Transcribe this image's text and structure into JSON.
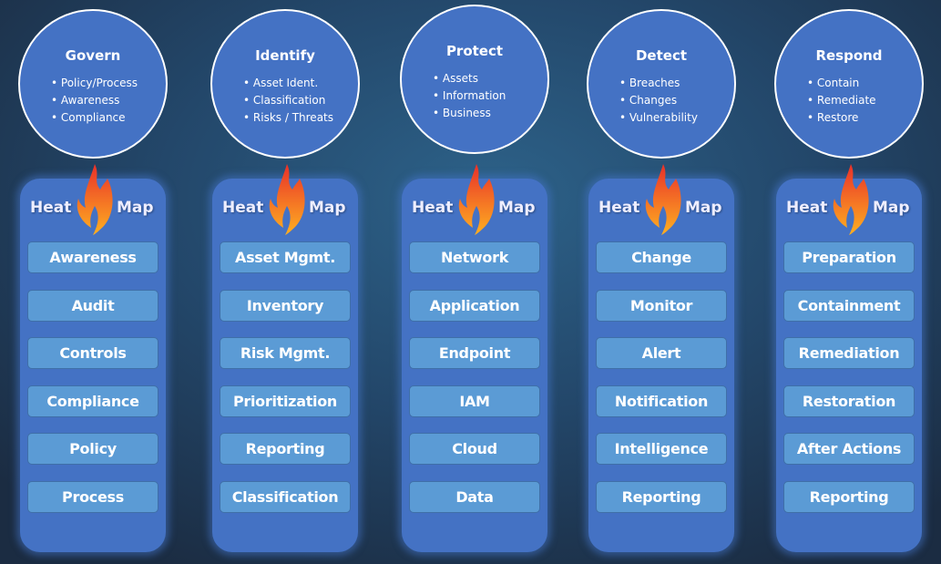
{
  "heat_label": "Heat",
  "map_label": "Map",
  "colors": {
    "circle": "#4472c4",
    "panel": "#4472c4",
    "button": "#5b9bd5",
    "flame_top": "#e8302a",
    "flame_bottom": "#ffb020"
  },
  "icons": {
    "flame": "flame-icon"
  },
  "columns": [
    {
      "title": "Govern",
      "bullets": [
        "Policy/Process",
        "Awareness",
        "Compliance"
      ],
      "items": [
        "Awareness",
        "Audit",
        "Controls",
        "Compliance",
        "Policy",
        "Process"
      ]
    },
    {
      "title": "Identify",
      "bullets": [
        "Asset Ident.",
        "Classification",
        "Risks / Threats"
      ],
      "items": [
        "Asset Mgmt.",
        "Inventory",
        "Risk Mgmt.",
        "Prioritization",
        "Reporting",
        "Classification"
      ]
    },
    {
      "title": "Protect",
      "bullets": [
        "Assets",
        "Information",
        "Business"
      ],
      "items": [
        "Network",
        "Application",
        "Endpoint",
        "IAM",
        "Cloud",
        "Data"
      ]
    },
    {
      "title": "Detect",
      "bullets": [
        "Breaches",
        "Changes",
        "Vulnerability"
      ],
      "items": [
        "Change",
        "Monitor",
        "Alert",
        "Notification",
        "Intelligence",
        "Reporting"
      ]
    },
    {
      "title": "Respond",
      "bullets": [
        "Contain",
        "Remediate",
        "Restore"
      ],
      "items": [
        "Preparation",
        "Containment",
        "Remediation",
        "Restoration",
        "After Actions",
        "Reporting"
      ]
    }
  ]
}
